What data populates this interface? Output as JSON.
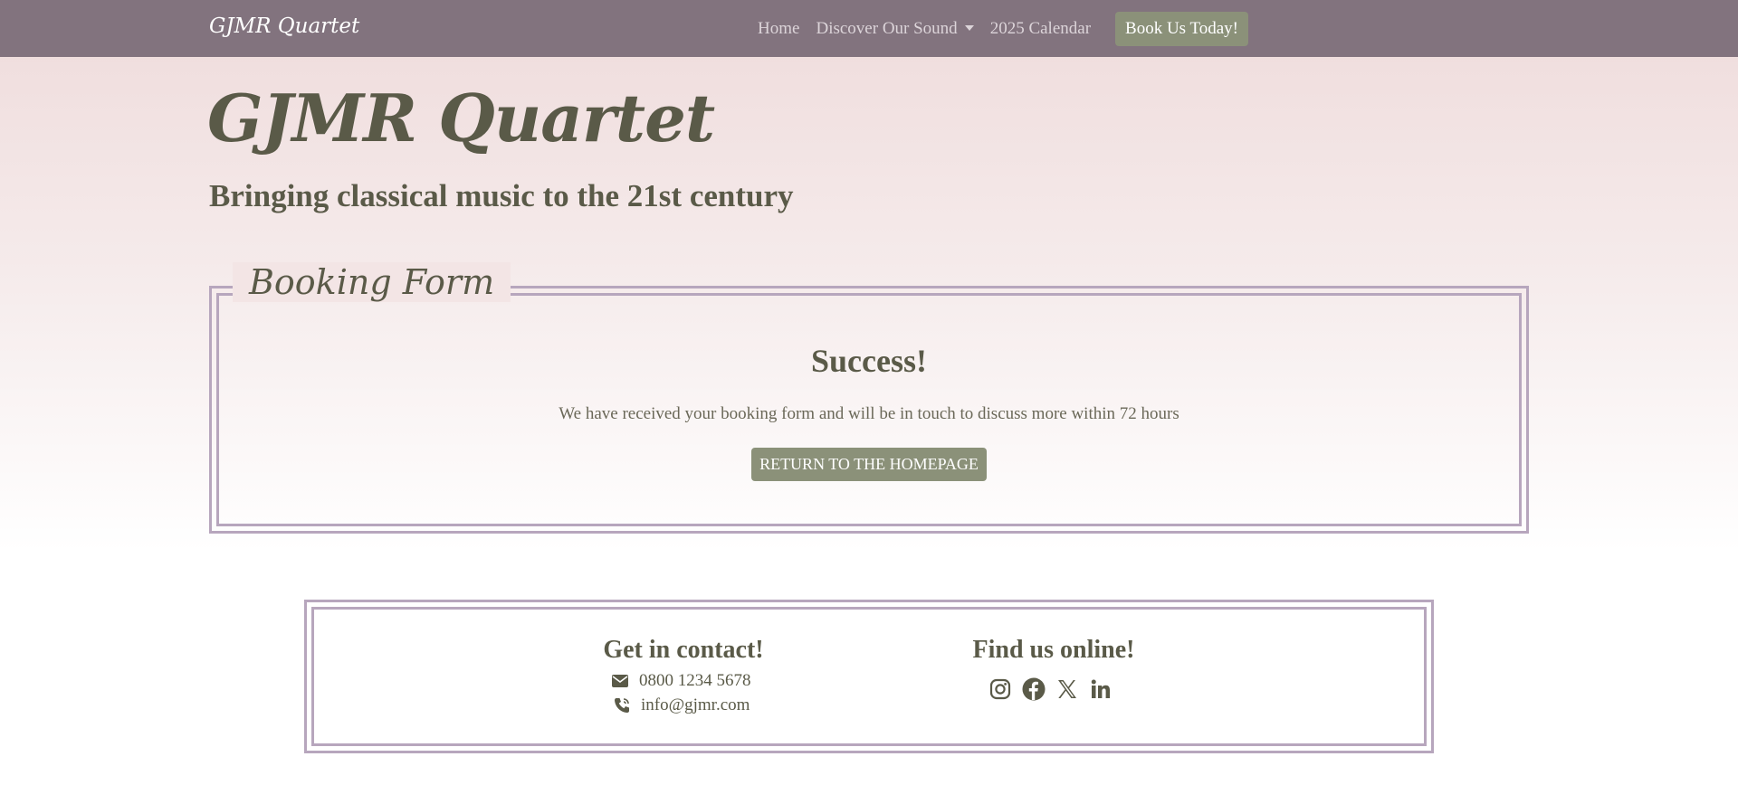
{
  "nav": {
    "brand": "GJMR Quartet",
    "links": [
      "Home",
      "Discover Our Sound",
      "2025 Calendar"
    ],
    "cta": "Book Us Today!"
  },
  "hero": {
    "title": "GJMR Quartet",
    "subtitle": "Bringing classical music to the 21st century"
  },
  "form": {
    "legend": "Booking Form",
    "success_title": "Success!",
    "success_message": "We have received your booking form and will be in touch to discuss more within 72 hours",
    "return_button": "RETURN TO THE HOMEPAGE"
  },
  "footer": {
    "contact_title": "Get in contact!",
    "phone": "0800 1234 5678",
    "email": "info@gjmr.com",
    "online_title": "Find us online!",
    "socials": [
      "instagram-icon",
      "facebook-icon",
      "x-twitter-icon",
      "linkedin-icon"
    ]
  },
  "colors": {
    "navbar": "#82737e",
    "accent_button": "#8b9179",
    "border": "#b7a6bd",
    "text": "#5a5a48"
  }
}
